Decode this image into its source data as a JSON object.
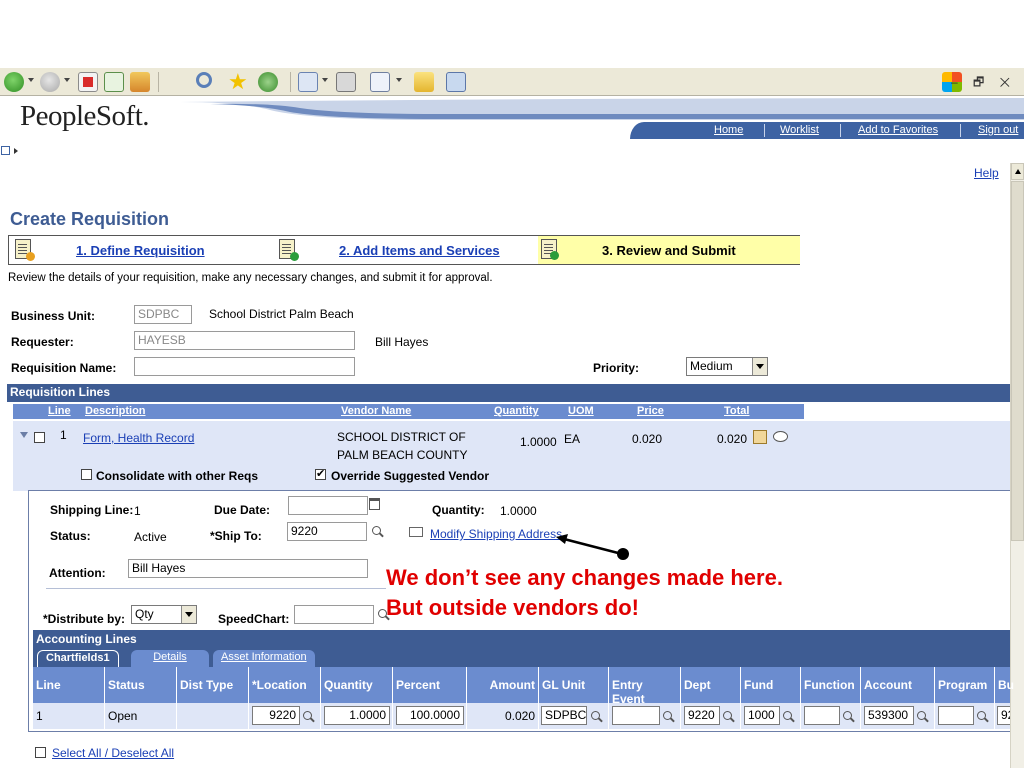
{
  "window": {
    "controls": "– 🗗 ✕"
  },
  "brand": {
    "logo": "PeopleSoft."
  },
  "nav": {
    "home": "Home",
    "worklist": "Worklist",
    "add_favorites": "Add to Favorites",
    "sign_out": "Sign out"
  },
  "help": "Help",
  "page_title": "Create Requisition",
  "steps": [
    {
      "label": "1. Define Requisition"
    },
    {
      "label": "2. Add Items and Services"
    },
    {
      "label": "3. Review and Submit"
    }
  ],
  "instructions": "Review the details of your requisition, make any necessary changes, and submit it for approval.",
  "form": {
    "business_unit_label": "Business Unit:",
    "business_unit_value": "SDPBC",
    "business_unit_desc": "School District Palm Beach",
    "requester_label": "Requester:",
    "requester_value": "HAYESB",
    "requester_name": "Bill Hayes",
    "req_name_label": "Requisition Name:",
    "req_name_value": "",
    "priority_label": "Priority:",
    "priority_value": "Medium"
  },
  "req_lines": {
    "title": "Requisition Lines",
    "headers": {
      "line": "Line",
      "description": "Description",
      "vendor": "Vendor Name",
      "quantity": "Quantity",
      "uom": "UOM",
      "price": "Price",
      "total": "Total"
    },
    "row": {
      "line": "1",
      "description": "Form, Health Record",
      "vendor_1": "SCHOOL DISTRICT OF",
      "vendor_2": "PALM BEACH COUNTY",
      "quantity": "1.0000",
      "uom": "EA",
      "price": "0.020",
      "total": "0.020"
    },
    "consolidate_label": "Consolidate with other Reqs",
    "override_label": "Override Suggested Vendor"
  },
  "shipping": {
    "ship_line_label": "Shipping Line:",
    "ship_line_value": "1",
    "due_date_label": "Due Date:",
    "due_date_value": "",
    "quantity_label": "Quantity:",
    "quantity_value": "1.0000",
    "status_label": "Status:",
    "status_value": "Active",
    "ship_to_label": "*Ship To:",
    "ship_to_value": "9220",
    "modify_link": "Modify Shipping Address",
    "attention_label": "Attention:",
    "attention_value": "Bill Hayes",
    "distribute_label": "*Distribute by:",
    "distribute_value": "Qty",
    "speedchart_label": "SpeedChart:",
    "speedchart_value": ""
  },
  "annotation": {
    "line1": "We don’t see any changes made here.",
    "line2": "But outside vendors do!"
  },
  "accounting": {
    "title": "Accounting Lines",
    "tabs": [
      "Chartfields1",
      "Details",
      "Asset Information"
    ],
    "headers": [
      "Line",
      "Status",
      "Dist Type",
      "*Location",
      "Quantity",
      "Percent",
      "Amount",
      "GL Unit",
      "Entry Event",
      "Dept",
      "Fund",
      "Function",
      "Account",
      "Program",
      "Bu"
    ],
    "row": {
      "line": "1",
      "status": "Open",
      "dist_type": "",
      "location": "9220",
      "quantity": "1.0000",
      "percent": "100.0000",
      "amount": "0.020",
      "gl_unit": "SDPBC",
      "entry_event": "",
      "dept": "9220",
      "fund": "1000",
      "function": "",
      "account": "539300",
      "program": "",
      "bu": "92"
    }
  },
  "select_all": "Select All / Deselect All",
  "colors": {
    "header_blue": "#3e5c93",
    "grid_blue": "#6b8ccf",
    "row_tint": "#dfe6f7",
    "annotation_red": "#e00000",
    "step_highlight": "#ffffa8"
  }
}
